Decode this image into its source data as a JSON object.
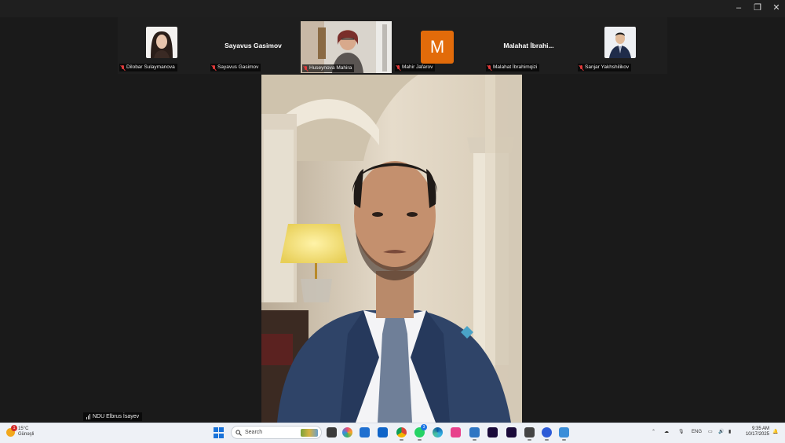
{
  "window": {
    "controls": {
      "minimize": "–",
      "restore": "❐",
      "close": "✕"
    }
  },
  "participants": [
    {
      "name": "Dilobar Sulaymanova",
      "tile_type": "photo",
      "muted": true
    },
    {
      "name": "Sayavus Gasimov",
      "tile_type": "name",
      "big_name": "Sayavus Gasimov",
      "muted": true
    },
    {
      "name": "Huseynova Mahira",
      "tile_type": "video",
      "muted": true
    },
    {
      "name": "Mahir Jafarov",
      "tile_type": "initial",
      "initial": "M",
      "muted": true
    },
    {
      "name": "Malahat İbrahimqizi",
      "tile_type": "name",
      "big_name": "Malahat  İbrahi...",
      "muted": true
    },
    {
      "name": "Sanjar Yakhshilikov",
      "tile_type": "photo",
      "muted": true
    }
  ],
  "main_speaker": {
    "name": "NDU Elbrus İsayev"
  },
  "colors": {
    "accent_avatar": "#e26b0a",
    "muted_icon": "#e03a3a",
    "start_button": "#1a73d9"
  },
  "taskbar": {
    "weather": {
      "temp": "15°C",
      "condition": "Günəşli",
      "badge": "1"
    },
    "search_placeholder": "Search",
    "whatsapp_badge": "3",
    "language": "ENG",
    "time": "9:35 AM",
    "date": "10/17/2025"
  }
}
